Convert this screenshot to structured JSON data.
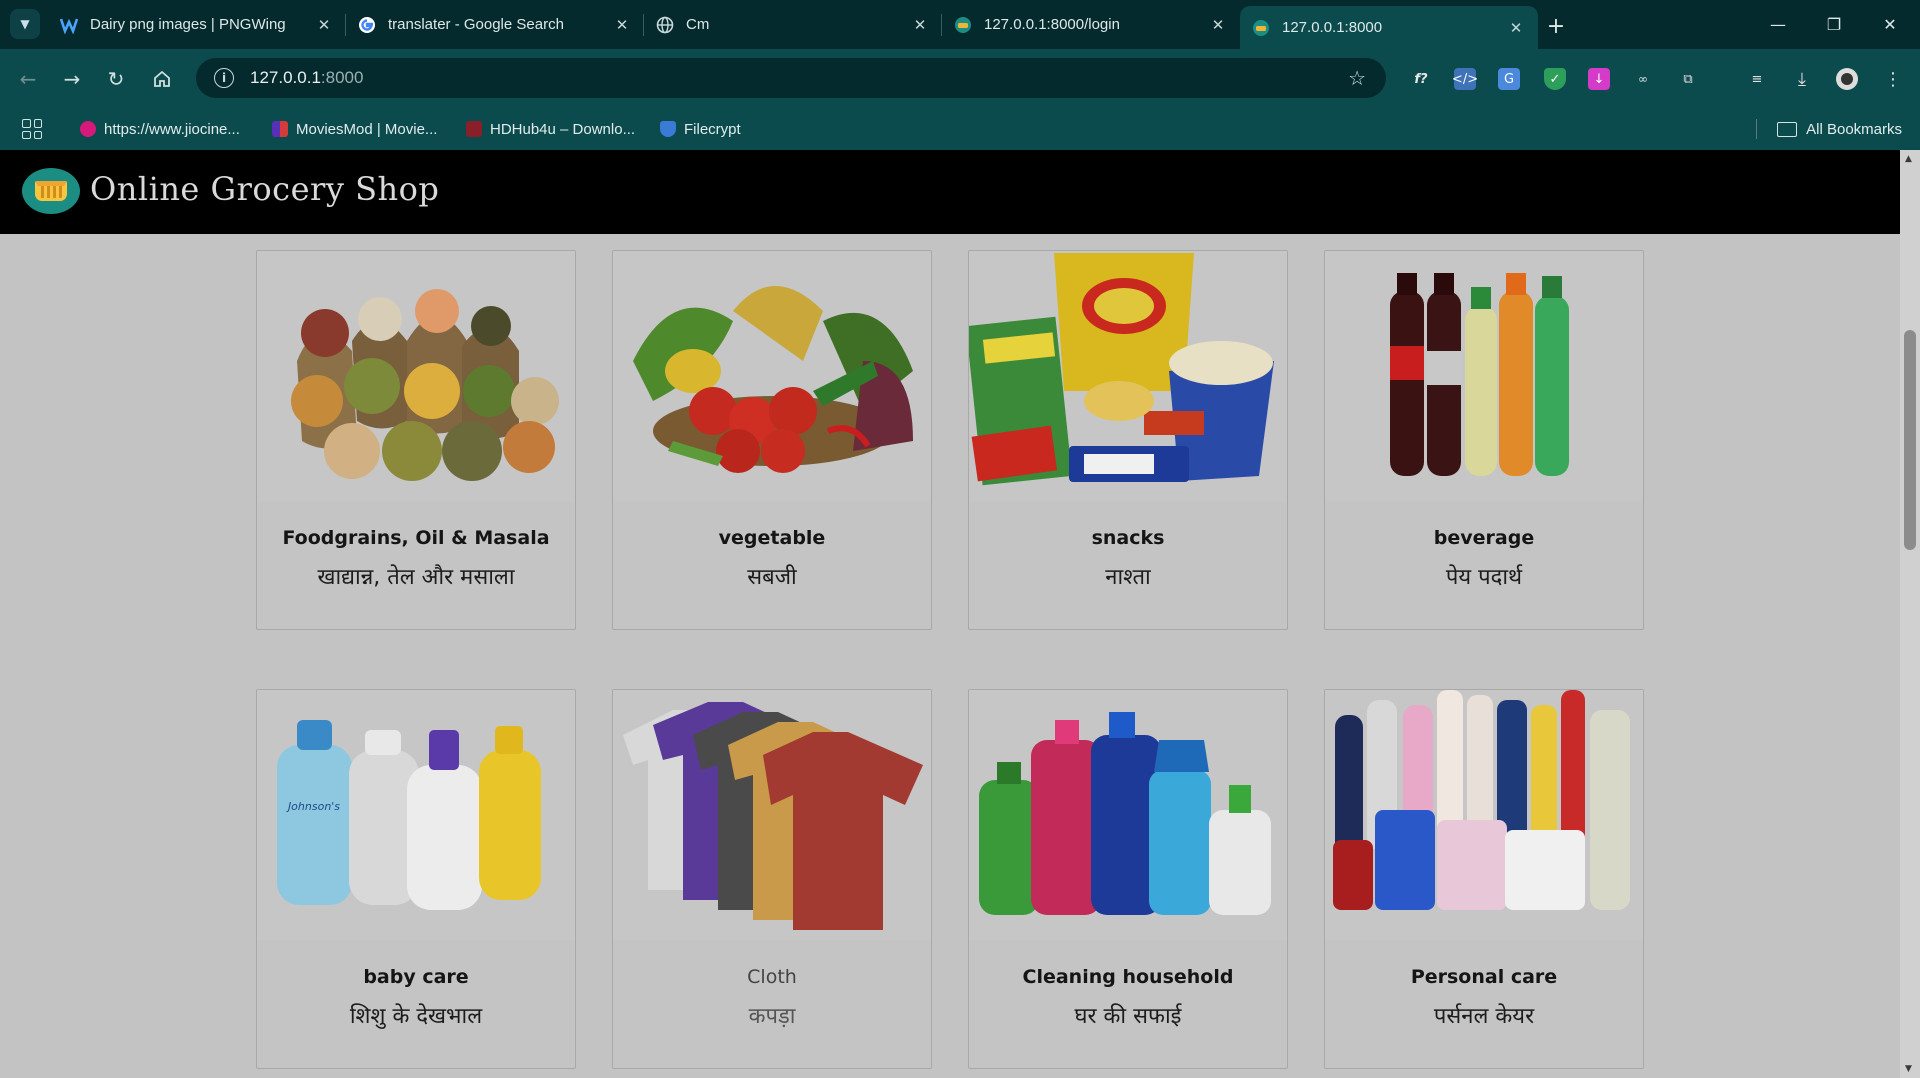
{
  "browser": {
    "tabs": [
      {
        "title": "Dairy png images | PNGWing",
        "icon": "pngwing-icon",
        "active": false
      },
      {
        "title": "translater - Google Search",
        "icon": "google-icon",
        "active": false
      },
      {
        "title": "Cm",
        "icon": "globe-icon",
        "active": false
      },
      {
        "title": "127.0.0.1:8000/login",
        "icon": "grocery-favicon",
        "active": false
      },
      {
        "title": "127.0.0.1:8000",
        "icon": "grocery-favicon",
        "active": true
      }
    ],
    "url_host": "127.0.0.1",
    "url_port": ":8000",
    "bookmarks": [
      {
        "label": "https://www.jiocine..."
      },
      {
        "label": "MoviesMod | Movie..."
      },
      {
        "label": "HDHub4u – Downlo..."
      },
      {
        "label": "Filecrypt"
      }
    ],
    "all_bookmarks": "All Bookmarks"
  },
  "site": {
    "title": "Online Grocery Shop"
  },
  "categories": [
    {
      "name": "Foodgrains, Oil & Masala",
      "hindi": "खाद्यान्न, तेल और मसाला"
    },
    {
      "name": "vegetable",
      "hindi": "सबजी"
    },
    {
      "name": "snacks",
      "hindi": "नाश्ता"
    },
    {
      "name": "beverage",
      "hindi": "पेय पदार्थ"
    },
    {
      "name": "baby care",
      "hindi": "शिशु के देखभाल"
    },
    {
      "name": "Cloth",
      "hindi": "कपड़ा"
    },
    {
      "name": "Cleaning household",
      "hindi": "घर की सफाई"
    },
    {
      "name": "Personal care",
      "hindi": "पर्सनल केयर"
    }
  ],
  "colors": {
    "tab_bar": "#052a2e",
    "toolbar": "#0b4a4d",
    "page_overlay": "#c3c3c3",
    "header": "#000000"
  }
}
